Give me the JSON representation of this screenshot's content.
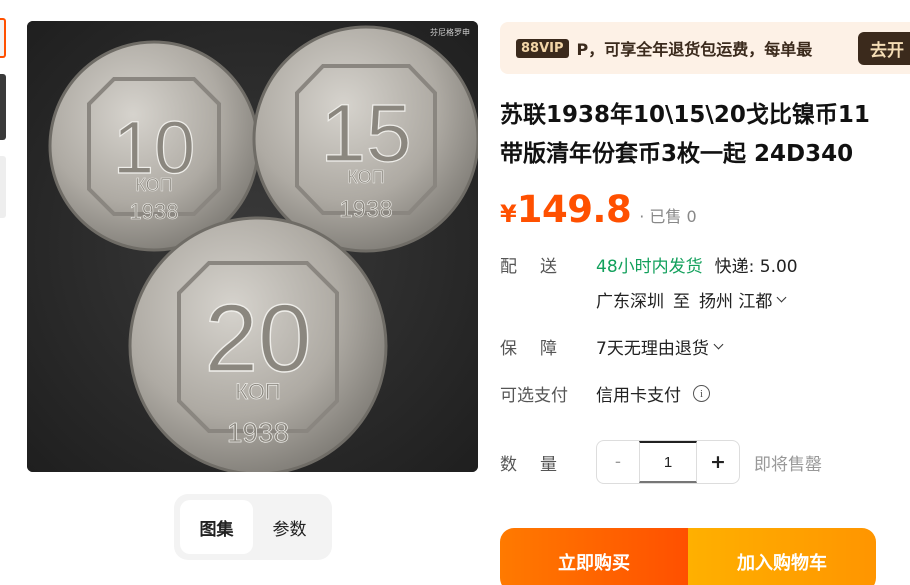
{
  "gallery": {
    "watermark": "芬尼格罗申",
    "tabs": [
      {
        "label": "图集",
        "active": true
      },
      {
        "label": "参数",
        "active": false
      }
    ],
    "coins": [
      {
        "denomination": "10",
        "unit": "КОП",
        "year": "1938"
      },
      {
        "denomination": "15",
        "unit": "КОП",
        "year": "1938"
      },
      {
        "denomination": "20",
        "unit": "КОП",
        "year": "1938"
      }
    ]
  },
  "vip": {
    "badge": "88VIP",
    "text": "P，可享全年退货包运费，每单最",
    "action": "去开"
  },
  "product": {
    "title_line1": "苏联1938年10\\15\\20戈比镍币11",
    "title_line2": "带版清年份套币3枚一起 24D340",
    "currency": "¥",
    "price": "149.8",
    "sold": "· 已售 0"
  },
  "shipping": {
    "label": "配送",
    "delivery_time": "48小时内发货",
    "fee": "快递: 5.00",
    "from": "广东深圳",
    "to_word": "至",
    "destination": "扬州 江都"
  },
  "guarantee": {
    "label": "保障",
    "value": "7天无理由退货"
  },
  "payment": {
    "label": "可选支付",
    "value": "信用卡支付"
  },
  "quantity": {
    "label": "数量",
    "minus": "-",
    "value": "1",
    "plus": "+",
    "status": "即将售罄"
  },
  "actions": {
    "buy_now": "立即购买",
    "add_to_cart": "加入购物车"
  },
  "colors": {
    "accent": "#ff5000",
    "green": "#12a05c",
    "vip_bg": "#fdf1e6"
  }
}
